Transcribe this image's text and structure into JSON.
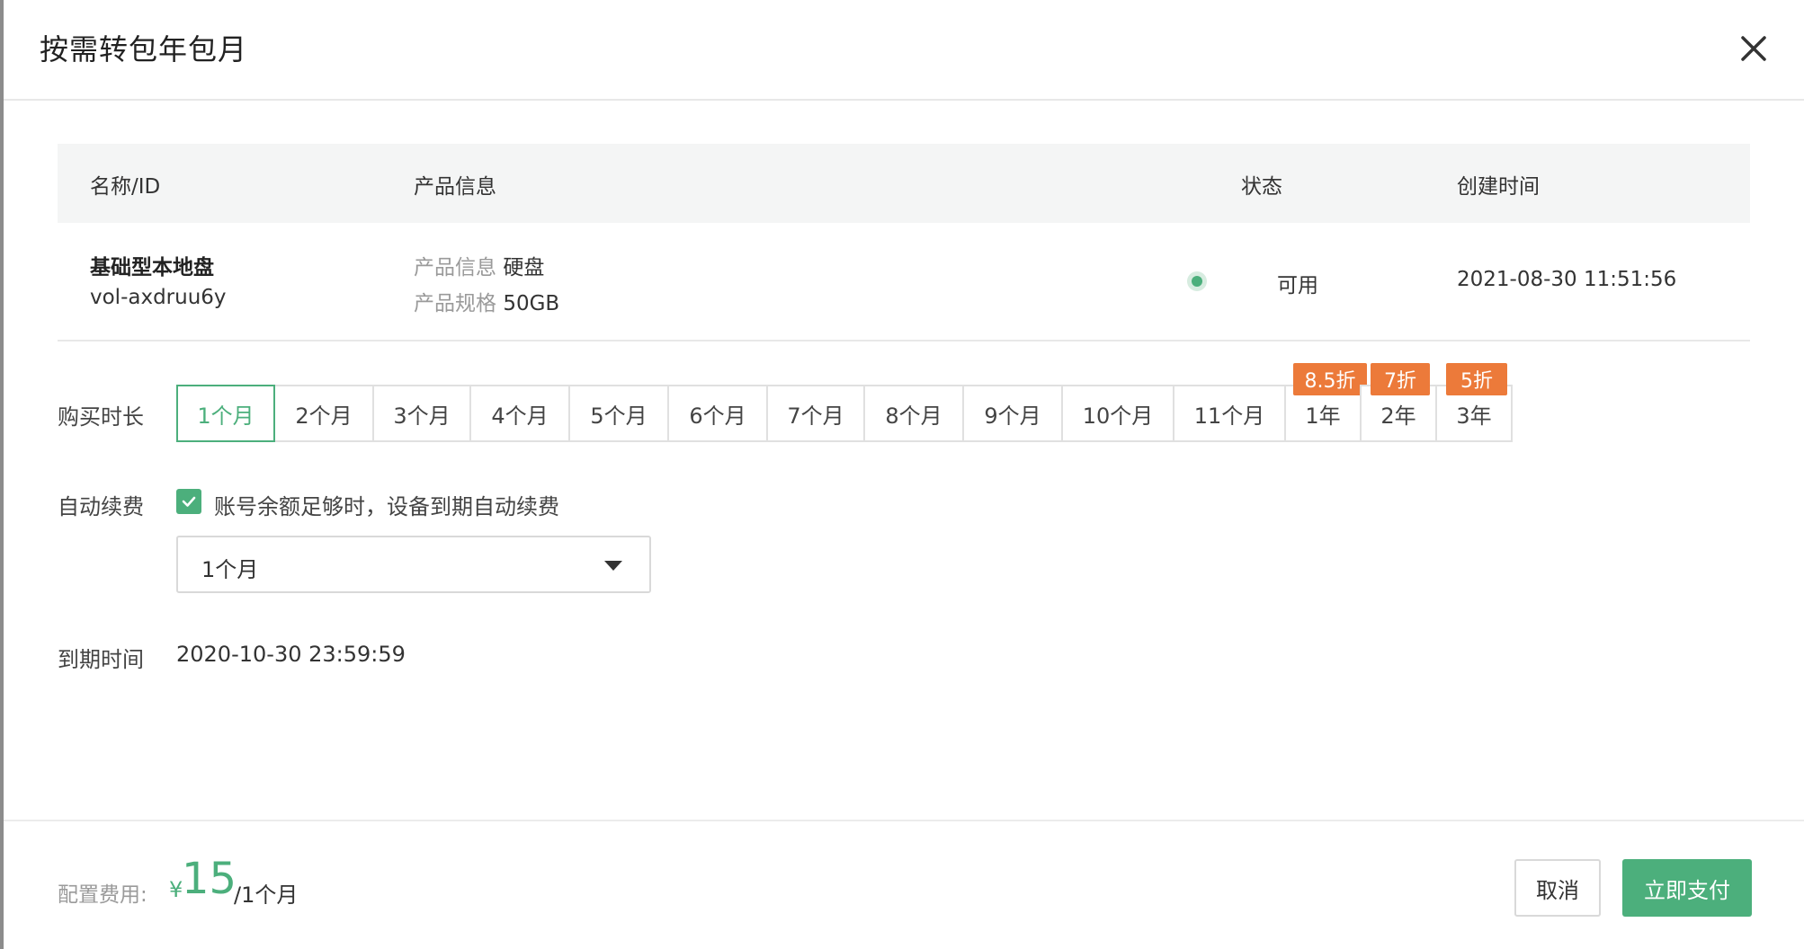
{
  "dialog": {
    "title": "按需转包年包月"
  },
  "table": {
    "columns": [
      "名称/ID",
      "产品信息",
      "状态",
      "创建时间"
    ],
    "row": {
      "name": "基础型本地盘",
      "id": "vol-axdruu6y",
      "info_label": "产品信息",
      "info_value": "硬盘",
      "spec_label": "产品规格",
      "spec_value": "50GB",
      "status": "可用",
      "status_color": "#4caf7c",
      "created": "2021-08-30 11:51:56"
    }
  },
  "duration": {
    "label": "购买时长",
    "selected": "1个月",
    "options": [
      {
        "label": "1个月",
        "badge": ""
      },
      {
        "label": "2个月",
        "badge": ""
      },
      {
        "label": "3个月",
        "badge": ""
      },
      {
        "label": "4个月",
        "badge": ""
      },
      {
        "label": "5个月",
        "badge": ""
      },
      {
        "label": "6个月",
        "badge": ""
      },
      {
        "label": "7个月",
        "badge": ""
      },
      {
        "label": "8个月",
        "badge": ""
      },
      {
        "label": "9个月",
        "badge": ""
      },
      {
        "label": "10个月",
        "badge": ""
      },
      {
        "label": "11个月",
        "badge": ""
      },
      {
        "label": "1年",
        "badge": "8.5折"
      },
      {
        "label": "2年",
        "badge": "7折"
      },
      {
        "label": "3年",
        "badge": "5折"
      }
    ]
  },
  "auto_renew": {
    "label": "自动续费",
    "checked": true,
    "text": "账号余额足够时，设备到期自动续费",
    "period_value": "1个月"
  },
  "expire": {
    "label": "到期时间",
    "value": "2020-10-30 23:59:59"
  },
  "footer": {
    "fee_label": "配置费用:",
    "currency": "¥",
    "amount": "15",
    "unit": "/1个月",
    "cancel_label": "取消",
    "pay_label": "立即支付"
  },
  "colors": {
    "accent": "#4caf7c",
    "badge": "#ec7a3a"
  }
}
